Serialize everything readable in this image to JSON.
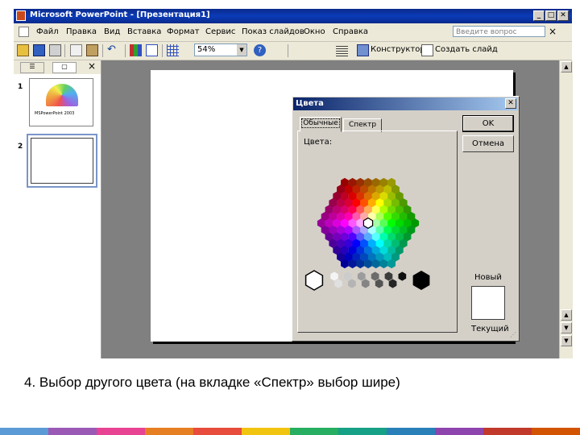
{
  "window": {
    "title": "Microsoft PowerPoint - [Презентация1]"
  },
  "menu": {
    "items": [
      "Файл",
      "Правка",
      "Вид",
      "Вставка",
      "Формат",
      "Сервис",
      "Показ слайдов",
      "Окно",
      "Справка"
    ],
    "ask_placeholder": "Введите вопрос",
    "close_glyph": "×"
  },
  "toolbar": {
    "zoom": "54%",
    "designer_label": "Конструктор",
    "new_slide_label": "Создать слайд"
  },
  "slides_pane": {
    "slide_numbers": [
      "1",
      "2"
    ],
    "thumb1_title": "MSPowerPoint 2003",
    "close_glyph": "×"
  },
  "dialog": {
    "title": "Цвета",
    "tabs": [
      "Обычные",
      "Спектр"
    ],
    "active_tab": "Обычные",
    "colors_label": "Цвета:",
    "ok_label": "OK",
    "cancel_label": "Отмена",
    "new_label": "Новый",
    "current_label": "Текущий",
    "new_color": "#ffffff",
    "current_color": "#ffffff"
  },
  "caption": "4.   Выбор другого цвета (на вкладке «Спектр» выбор шире)",
  "colors": {
    "titlebar": "#0a2a8c",
    "dialog_bg": "#d4d0c8",
    "workspace": "#808080"
  }
}
